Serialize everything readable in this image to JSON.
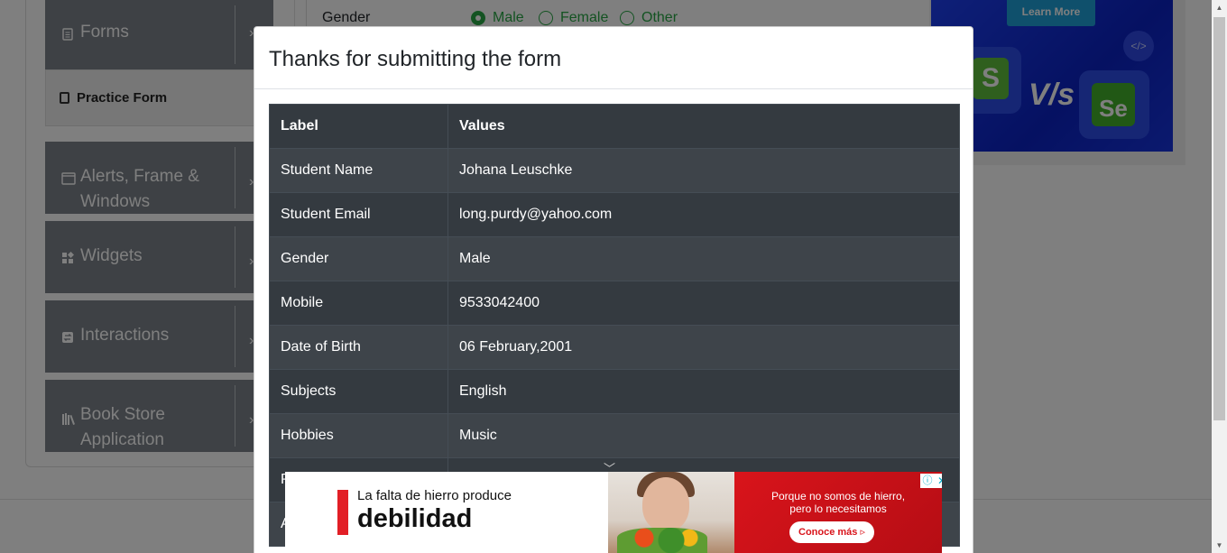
{
  "sidebar": {
    "groups": [
      {
        "label": "Forms",
        "icon": "document-icon"
      },
      {
        "label": "Alerts, Frame & Windows",
        "icon": "window-icon"
      },
      {
        "label": "Widgets",
        "icon": "widgets-icon"
      },
      {
        "label": "Interactions",
        "icon": "interactions-icon"
      },
      {
        "label": "Book Store Application",
        "icon": "books-icon"
      }
    ],
    "active_item": {
      "label": "Practice Form",
      "icon": "html5-icon"
    }
  },
  "form": {
    "gender_label": "Gender",
    "gender_options": [
      {
        "label": "Male",
        "checked": true
      },
      {
        "label": "Female",
        "checked": false
      },
      {
        "label": "Other",
        "checked": false
      }
    ]
  },
  "top_ad": {
    "cta": "Learn More",
    "tile_left": "S",
    "versus": "V/s",
    "tile_right": "Se"
  },
  "modal": {
    "title": "Thanks for submitting the form",
    "headers": {
      "label": "Label",
      "values": "Values"
    },
    "rows": [
      {
        "label": "Student Name",
        "value": "Johana Leuschke"
      },
      {
        "label": "Student Email",
        "value": "long.purdy@yahoo.com"
      },
      {
        "label": "Gender",
        "value": "Male"
      },
      {
        "label": "Mobile",
        "value": "9533042400"
      },
      {
        "label": "Date of Birth",
        "value": "06 February,2001"
      },
      {
        "label": "Subjects",
        "value": "English"
      },
      {
        "label": "Hobbies",
        "value": "Music"
      },
      {
        "label": "P",
        "value": ""
      },
      {
        "label": "A",
        "value": ""
      }
    ]
  },
  "bottom_ad": {
    "line1": "La falta de hierro produce",
    "line2": "debilidad",
    "right_line1": "Porque no somos de hierro,",
    "right_line2": "pero lo necesitamos",
    "cta": "Conoce más ▹",
    "info": "ⓘ",
    "close": "✕"
  },
  "colors": {
    "menu_bg": "#7c838a",
    "table_dark": "#343a40",
    "table_stripe": "#3e444a",
    "accent_green": "#28a745",
    "ad_red": "#d9141b"
  }
}
